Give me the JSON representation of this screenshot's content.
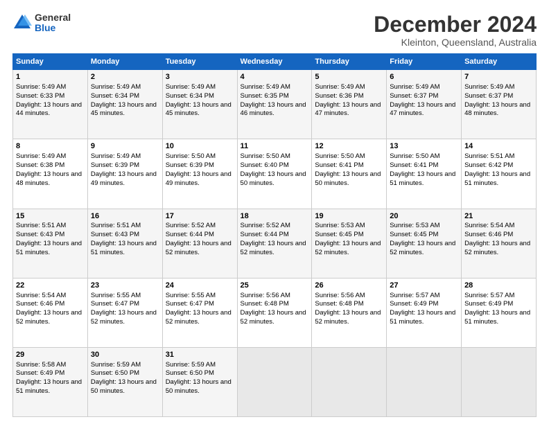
{
  "logo": {
    "general": "General",
    "blue": "Blue"
  },
  "header": {
    "title": "December 2024",
    "subtitle": "Kleinton, Queensland, Australia"
  },
  "days": [
    "Sunday",
    "Monday",
    "Tuesday",
    "Wednesday",
    "Thursday",
    "Friday",
    "Saturday"
  ],
  "weeks": [
    [
      {
        "num": "1",
        "rise": "5:49 AM",
        "set": "6:33 PM",
        "daylight": "13 hours and 44 minutes."
      },
      {
        "num": "2",
        "rise": "5:49 AM",
        "set": "6:34 PM",
        "daylight": "13 hours and 45 minutes."
      },
      {
        "num": "3",
        "rise": "5:49 AM",
        "set": "6:34 PM",
        "daylight": "13 hours and 45 minutes."
      },
      {
        "num": "4",
        "rise": "5:49 AM",
        "set": "6:35 PM",
        "daylight": "13 hours and 46 minutes."
      },
      {
        "num": "5",
        "rise": "5:49 AM",
        "set": "6:36 PM",
        "daylight": "13 hours and 47 minutes."
      },
      {
        "num": "6",
        "rise": "5:49 AM",
        "set": "6:37 PM",
        "daylight": "13 hours and 47 minutes."
      },
      {
        "num": "7",
        "rise": "5:49 AM",
        "set": "6:37 PM",
        "daylight": "13 hours and 48 minutes."
      }
    ],
    [
      {
        "num": "8",
        "rise": "5:49 AM",
        "set": "6:38 PM",
        "daylight": "13 hours and 48 minutes."
      },
      {
        "num": "9",
        "rise": "5:49 AM",
        "set": "6:39 PM",
        "daylight": "13 hours and 49 minutes."
      },
      {
        "num": "10",
        "rise": "5:50 AM",
        "set": "6:39 PM",
        "daylight": "13 hours and 49 minutes."
      },
      {
        "num": "11",
        "rise": "5:50 AM",
        "set": "6:40 PM",
        "daylight": "13 hours and 50 minutes."
      },
      {
        "num": "12",
        "rise": "5:50 AM",
        "set": "6:41 PM",
        "daylight": "13 hours and 50 minutes."
      },
      {
        "num": "13",
        "rise": "5:50 AM",
        "set": "6:41 PM",
        "daylight": "13 hours and 51 minutes."
      },
      {
        "num": "14",
        "rise": "5:51 AM",
        "set": "6:42 PM",
        "daylight": "13 hours and 51 minutes."
      }
    ],
    [
      {
        "num": "15",
        "rise": "5:51 AM",
        "set": "6:43 PM",
        "daylight": "13 hours and 51 minutes."
      },
      {
        "num": "16",
        "rise": "5:51 AM",
        "set": "6:43 PM",
        "daylight": "13 hours and 51 minutes."
      },
      {
        "num": "17",
        "rise": "5:52 AM",
        "set": "6:44 PM",
        "daylight": "13 hours and 52 minutes."
      },
      {
        "num": "18",
        "rise": "5:52 AM",
        "set": "6:44 PM",
        "daylight": "13 hours and 52 minutes."
      },
      {
        "num": "19",
        "rise": "5:53 AM",
        "set": "6:45 PM",
        "daylight": "13 hours and 52 minutes."
      },
      {
        "num": "20",
        "rise": "5:53 AM",
        "set": "6:45 PM",
        "daylight": "13 hours and 52 minutes."
      },
      {
        "num": "21",
        "rise": "5:54 AM",
        "set": "6:46 PM",
        "daylight": "13 hours and 52 minutes."
      }
    ],
    [
      {
        "num": "22",
        "rise": "5:54 AM",
        "set": "6:46 PM",
        "daylight": "13 hours and 52 minutes."
      },
      {
        "num": "23",
        "rise": "5:55 AM",
        "set": "6:47 PM",
        "daylight": "13 hours and 52 minutes."
      },
      {
        "num": "24",
        "rise": "5:55 AM",
        "set": "6:47 PM",
        "daylight": "13 hours and 52 minutes."
      },
      {
        "num": "25",
        "rise": "5:56 AM",
        "set": "6:48 PM",
        "daylight": "13 hours and 52 minutes."
      },
      {
        "num": "26",
        "rise": "5:56 AM",
        "set": "6:48 PM",
        "daylight": "13 hours and 52 minutes."
      },
      {
        "num": "27",
        "rise": "5:57 AM",
        "set": "6:49 PM",
        "daylight": "13 hours and 51 minutes."
      },
      {
        "num": "28",
        "rise": "5:57 AM",
        "set": "6:49 PM",
        "daylight": "13 hours and 51 minutes."
      }
    ],
    [
      {
        "num": "29",
        "rise": "5:58 AM",
        "set": "6:49 PM",
        "daylight": "13 hours and 51 minutes."
      },
      {
        "num": "30",
        "rise": "5:59 AM",
        "set": "6:50 PM",
        "daylight": "13 hours and 50 minutes."
      },
      {
        "num": "31",
        "rise": "5:59 AM",
        "set": "6:50 PM",
        "daylight": "13 hours and 50 minutes."
      },
      null,
      null,
      null,
      null
    ]
  ]
}
